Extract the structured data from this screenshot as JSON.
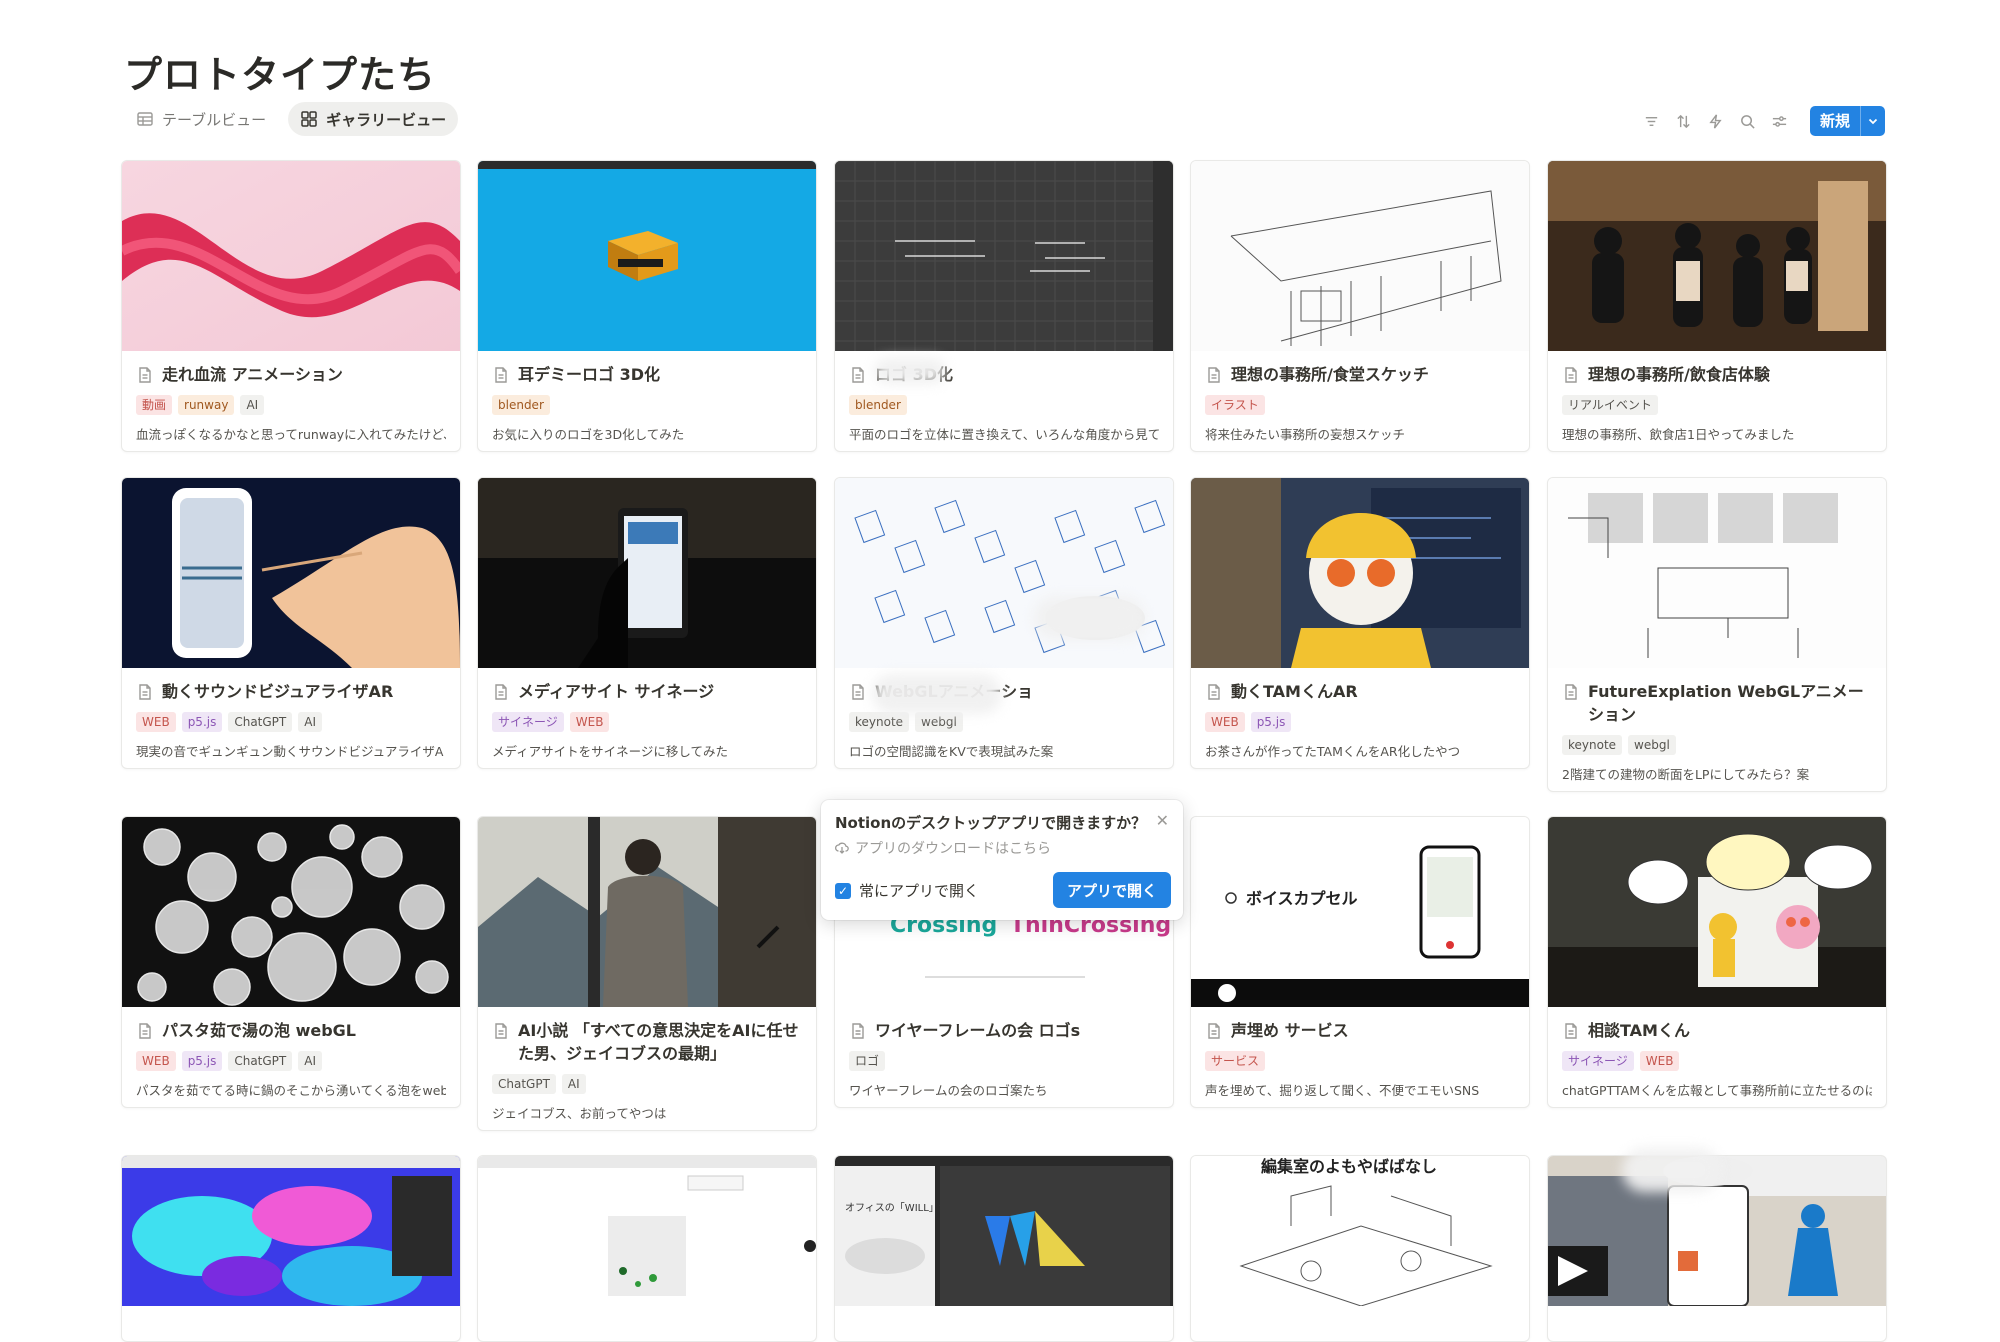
{
  "page": {
    "title": "プロトタイプたち"
  },
  "views": [
    {
      "label": "テーブルビュー",
      "icon": "table-icon"
    },
    {
      "label": "ギャラリービュー",
      "icon": "gallery-icon"
    }
  ],
  "toolbar": {
    "new_label": "新規"
  },
  "cards": [
    {
      "title": "走れ血流 アニメーション",
      "tags": [
        {
          "label": "動画",
          "color": "red"
        },
        {
          "label": "runway",
          "color": "orange"
        },
        {
          "label": "AI",
          "color": "gray"
        }
      ],
      "desc": "血流っぽくなるかなと思ってrunwayに入れてみたけど、"
    },
    {
      "title": "耳デミーロゴ 3D化",
      "tags": [
        {
          "label": "blender",
          "color": "orange"
        }
      ],
      "desc": "お気に入りのロゴを3D化してみた"
    },
    {
      "title": "ロゴ 3D化",
      "tags": [
        {
          "label": "blender",
          "color": "orange"
        }
      ],
      "desc": "平面のロゴを立体に置き換えて、いろんな角度から見て"
    },
    {
      "title": "理想の事務所/食堂スケッチ",
      "tags": [
        {
          "label": "イラスト",
          "color": "red"
        }
      ],
      "desc": "将来住みたい事務所の妄想スケッチ"
    },
    {
      "title": "理想の事務所/飲食店体験",
      "tags": [
        {
          "label": "リアルイベント",
          "color": "gray"
        }
      ],
      "desc": "理想の事務所、飲食店1日やってみました"
    },
    {
      "title": "動くサウンドビジュアライザAR",
      "tags": [
        {
          "label": "WEB",
          "color": "red"
        },
        {
          "label": "p5.js",
          "color": "purple"
        },
        {
          "label": "ChatGPT",
          "color": "gray"
        },
        {
          "label": "AI",
          "color": "gray"
        }
      ],
      "desc": "現実の音でギュンギュン動くサウンドビジュアライザA"
    },
    {
      "title": "メディアサイト サイネージ",
      "tags": [
        {
          "label": "サイネージ",
          "color": "purple"
        },
        {
          "label": "WEB",
          "color": "red"
        }
      ],
      "desc": "メディアサイトをサイネージに移してみた"
    },
    {
      "title": "WebGLアニメーショ",
      "tags": [
        {
          "label": "keynote",
          "color": "gray"
        },
        {
          "label": "webgl",
          "color": "gray"
        }
      ],
      "desc": "ロゴの空間認識をKVで表現試みた案"
    },
    {
      "title": "動くTAMくんAR",
      "tags": [
        {
          "label": "WEB",
          "color": "red"
        },
        {
          "label": "p5.js",
          "color": "purple"
        }
      ],
      "desc": "お茶さんが作ってたTAMくんをAR化したやつ"
    },
    {
      "title": "FutureExplation WebGLアニメーション",
      "tags": [
        {
          "label": "keynote",
          "color": "gray"
        },
        {
          "label": "webgl",
          "color": "gray"
        }
      ],
      "desc": "2階建ての建物の断面をLPにしてみたら？案"
    },
    {
      "title": "パスタ茹で湯の泡 webGL",
      "tags": [
        {
          "label": "WEB",
          "color": "red"
        },
        {
          "label": "p5.js",
          "color": "purple"
        },
        {
          "label": "ChatGPT",
          "color": "gray"
        },
        {
          "label": "AI",
          "color": "gray"
        }
      ],
      "desc": "パスタを茹でてる時に鍋のそこから湧いてくる泡をweb"
    },
    {
      "title": "AI小説 「すべての意思決定をAIに任せた男、ジェイコブスの最期」",
      "tags": [
        {
          "label": "ChatGPT",
          "color": "gray"
        },
        {
          "label": "AI",
          "color": "gray"
        }
      ],
      "desc": "ジェイコブス、お前ってやつは"
    },
    {
      "title": "ワイヤーフレームの会 ロゴs",
      "tags": [
        {
          "label": "ロゴ",
          "color": "gray"
        }
      ],
      "desc": "ワイヤーフレームの会のロゴ案たち"
    },
    {
      "title": "声埋め サービス",
      "tags": [
        {
          "label": "サービス",
          "color": "red"
        }
      ],
      "desc": "声を埋めて、掘り返して聞く、不便でエモいSNS"
    },
    {
      "title": "相談TAMくん",
      "tags": [
        {
          "label": "サイネージ",
          "color": "purple"
        },
        {
          "label": "WEB",
          "color": "red"
        }
      ],
      "desc": "chatGPTTAMくんを広報として事務所前に立たせるのは"
    }
  ],
  "thumb_text": {
    "voice_capsule": "ボイスカプセル",
    "crossing_left": "Crossing",
    "crossing_right": "ThinCrossing",
    "editorial": "編集室のよもやばばなし",
    "office_will": "オフィスの「WILL」がきっ"
  },
  "popup": {
    "question": "Notionのデスクトップアプリで開きますか？",
    "download": "アプリのダウンロードはこちら",
    "always_label": "常にアプリで開く",
    "open_label": "アプリで開く"
  }
}
